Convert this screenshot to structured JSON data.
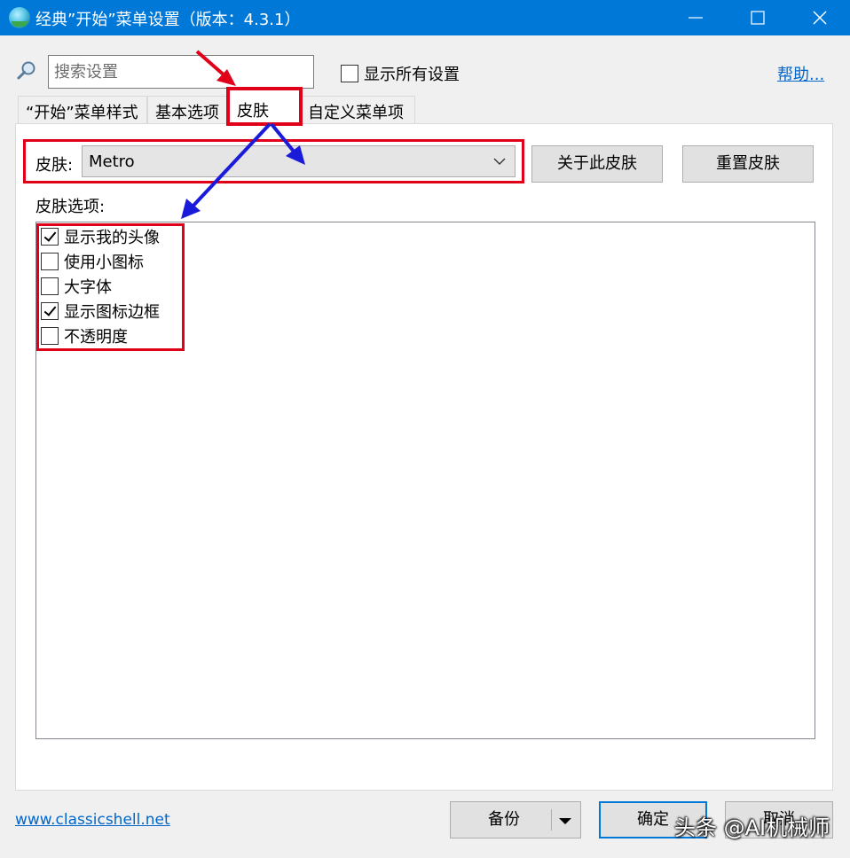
{
  "window": {
    "title": "经典”开始”菜单设置（版本：4.3.1）",
    "titlebar_color": "#0078d7"
  },
  "search": {
    "placeholder": "搜索设置",
    "value": ""
  },
  "show_all": {
    "label": "显示所有设置",
    "checked": false
  },
  "help": {
    "label": "帮助..."
  },
  "tabs": [
    {
      "label": "“开始”菜单样式",
      "active": false
    },
    {
      "label": "基本选项",
      "active": false
    },
    {
      "label": "皮肤",
      "active": true
    },
    {
      "label": "自定义菜单项",
      "active": false
    }
  ],
  "skin": {
    "label": "皮肤:",
    "selected": "Metro",
    "about_button": "关于此皮肤",
    "reset_button": "重置皮肤"
  },
  "options": {
    "label": "皮肤选项:",
    "items": [
      {
        "label": "显示我的头像",
        "checked": true
      },
      {
        "label": "使用小图标",
        "checked": false
      },
      {
        "label": "大字体",
        "checked": false
      },
      {
        "label": "显示图标边框",
        "checked": true
      },
      {
        "label": "不透明度",
        "checked": false
      }
    ]
  },
  "footer": {
    "link": "www.classicshell.net",
    "backup_button": "备份",
    "ok_button": "确定",
    "cancel_button": "取消"
  },
  "annotations": {
    "highlight_color": "#e0001a",
    "arrow_red": "#e0001a",
    "arrow_blue": "#1a1adb"
  },
  "watermark": "头条 @AI机械师"
}
